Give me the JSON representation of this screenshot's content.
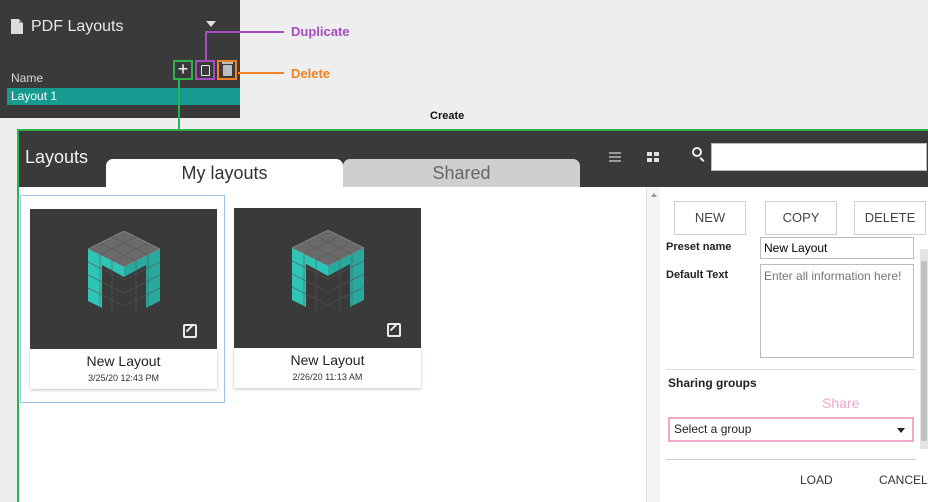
{
  "mini_panel": {
    "title": "PDF Layouts",
    "name_label": "Name",
    "add_symbol": "+",
    "selected_row": "Layout 1"
  },
  "callouts": {
    "duplicate": "Duplicate",
    "delete": "Delete",
    "create": "Create"
  },
  "dialog": {
    "title": "Layouts",
    "tabs": [
      {
        "label": "My layouts",
        "active": true
      },
      {
        "label": "Shared",
        "active": false
      }
    ],
    "search_value": ""
  },
  "cards": [
    {
      "name": "New Layout",
      "date": "3/25/20 12:43 PM",
      "selected": true
    },
    {
      "name": "New Layout",
      "date": "2/26/20 11:13 AM",
      "selected": false
    }
  ],
  "side_panel": {
    "buttons": {
      "new": "NEW",
      "copy": "COPY",
      "delete": "DELETE"
    },
    "preset_label": "Preset name",
    "preset_value": "New Layout",
    "default_label": "Default Text",
    "default_placeholder": "Enter all information here!",
    "sharing_label": "Sharing groups",
    "share_link": "Share",
    "group_select_value": "Select a group",
    "load": "LOAD",
    "cancel": "CANCEL"
  },
  "colors": {
    "dark": "#3a3a3a",
    "teal_row": "#179a8f",
    "duplicate": "#a64dc1",
    "delete": "#f08222",
    "create": "#2db34a",
    "share_pink": "#f2a8c6",
    "logo_teal": "#2ec4b6"
  }
}
